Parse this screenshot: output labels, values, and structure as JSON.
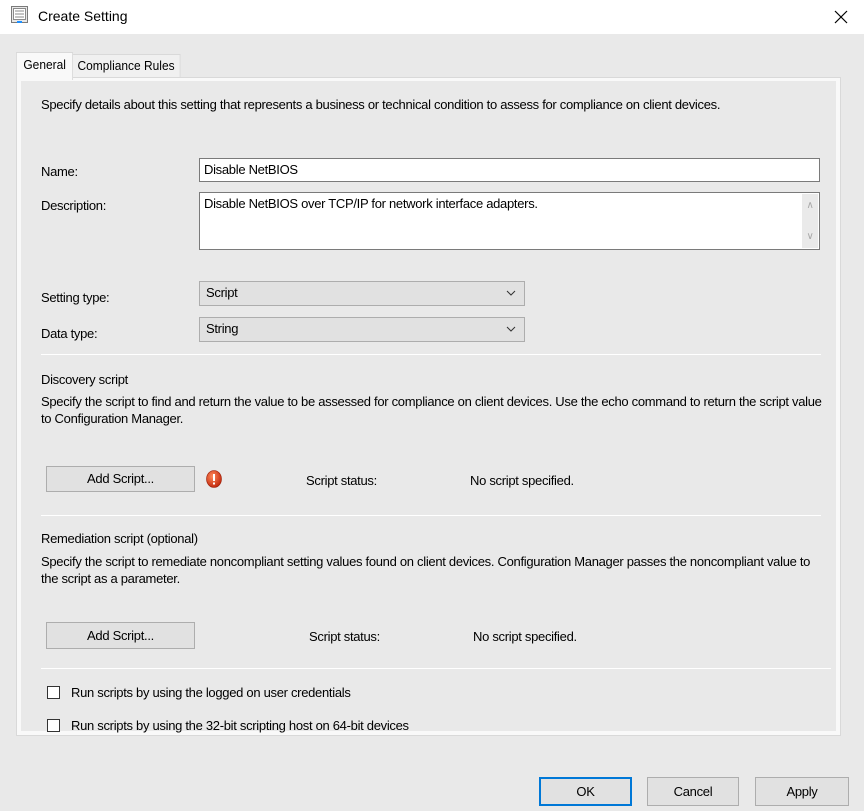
{
  "window": {
    "title": "Create Setting",
    "icon": "dialog-form-icon",
    "close_icon": "close-icon"
  },
  "tabs": [
    {
      "label": "General",
      "active": true
    },
    {
      "label": "Compliance Rules",
      "active": false
    }
  ],
  "general": {
    "intro": "Specify details about this setting that represents a business or technical condition to assess for compliance on client devices.",
    "name_label": "Name:",
    "name_value": "Disable NetBIOS",
    "description_label": "Description:",
    "description_value": "Disable NetBIOS over TCP/IP for network interface adapters.",
    "setting_type_label": "Setting type:",
    "setting_type_value": "Script",
    "data_type_label": "Data type:",
    "data_type_value": "String"
  },
  "discovery": {
    "heading": "Discovery script",
    "description": "Specify the script to find and return the value to be assessed for compliance on client devices. Use the echo command to return the script value to Configuration Manager.",
    "add_button": "Add Script...",
    "status_icon": "error-icon",
    "status_label": "Script status:",
    "status_value": "No script specified."
  },
  "remediation": {
    "heading": "Remediation script (optional)",
    "description": "Specify the script to remediate noncompliant setting values found on client devices. Configuration Manager passes the noncompliant value to the script as a parameter.",
    "add_button": "Add Script...",
    "status_label": "Script status:",
    "status_value": "No script specified."
  },
  "options": [
    {
      "label": "Run scripts by using the logged on user credentials",
      "checked": false
    },
    {
      "label": "Run scripts by using the 32-bit scripting host on 64-bit devices",
      "checked": false
    }
  ],
  "footer": {
    "ok": "OK",
    "cancel": "Cancel",
    "apply": "Apply"
  },
  "colors": {
    "default_button_border": "#0078d7",
    "error_icon": "#d83a1a"
  }
}
